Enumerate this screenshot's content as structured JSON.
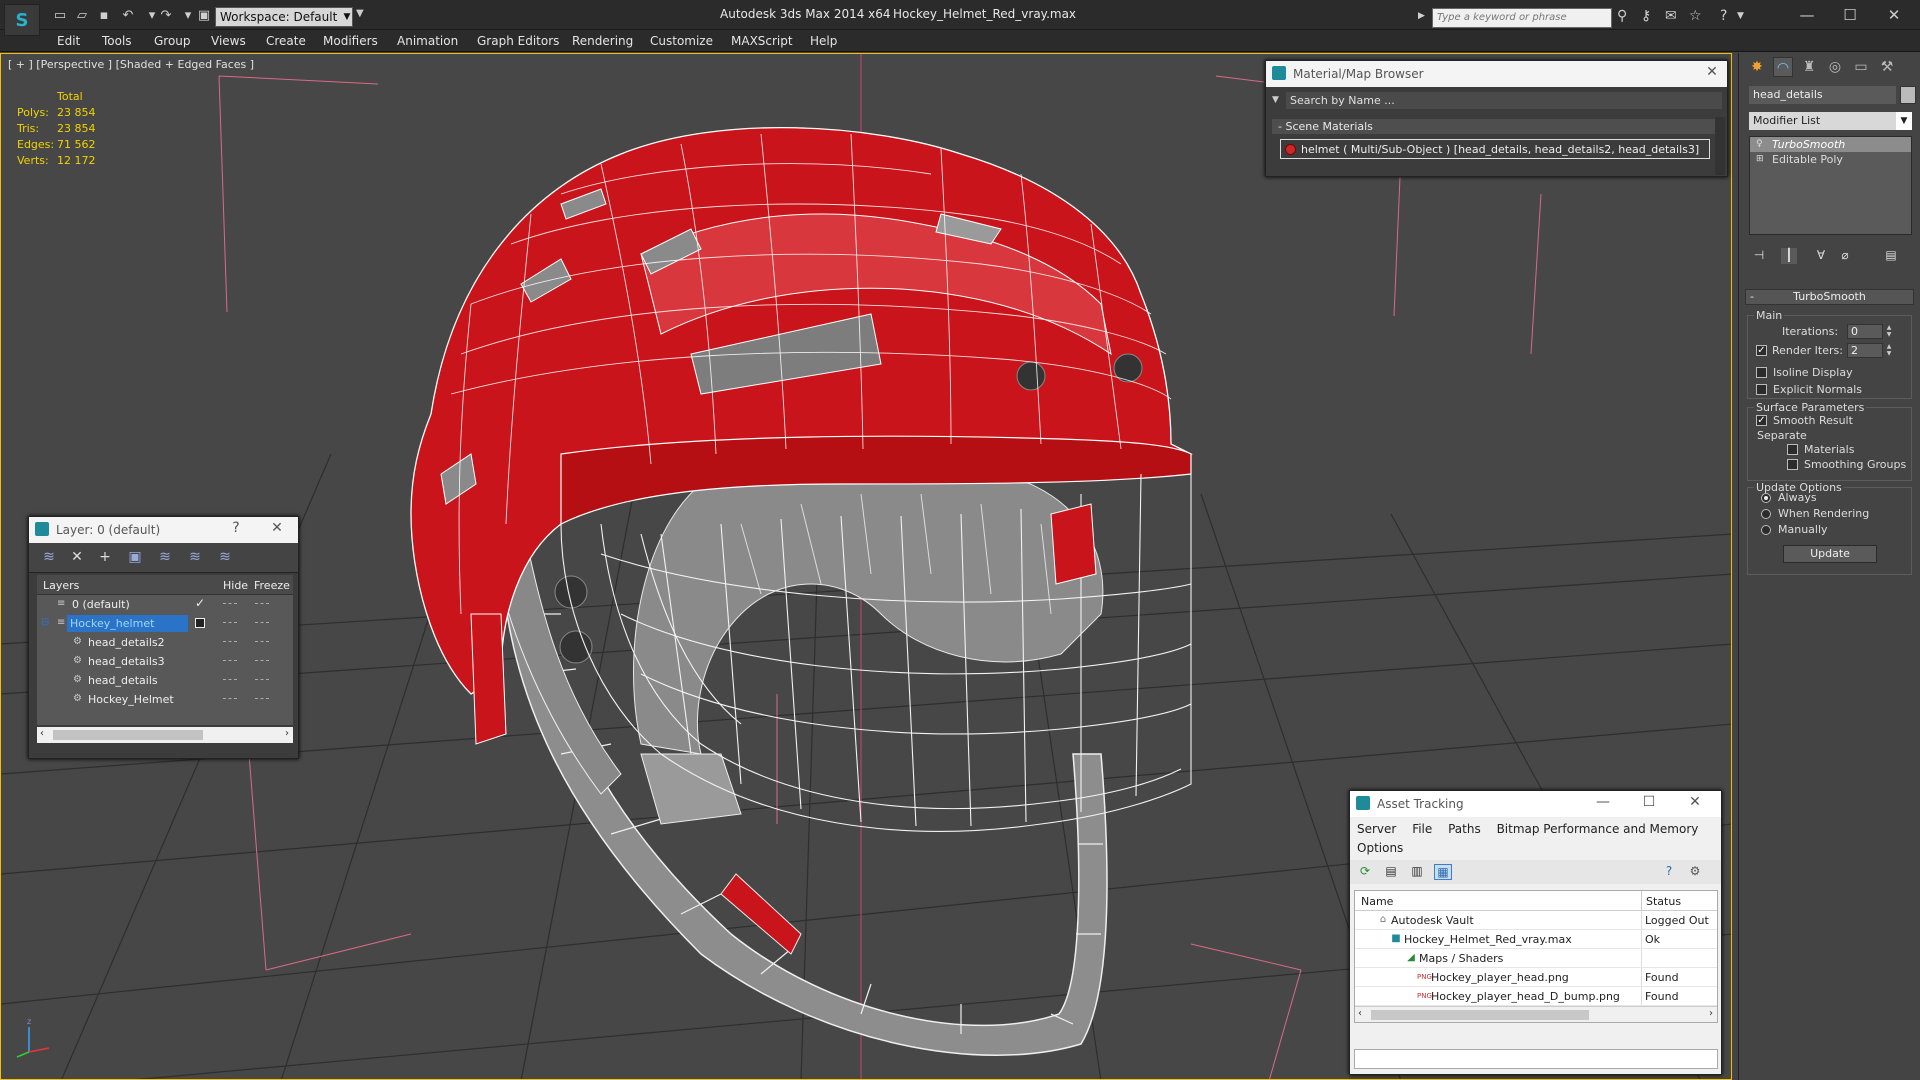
{
  "titlebar": {
    "workspace": "Workspace: Default",
    "app_title": "Autodesk 3ds Max  2014 x64",
    "file_title": "Hockey_Helmet_Red_vray.max",
    "search_placeholder": "Type a keyword or phrase"
  },
  "menu": [
    "Edit",
    "Tools",
    "Group",
    "Views",
    "Create",
    "Modifiers",
    "Animation",
    "Graph Editors",
    "Rendering",
    "Customize",
    "MAXScript",
    "Help"
  ],
  "viewport": {
    "label": "[ + ] [Perspective ] [Shaded + Edged Faces ]",
    "stats": {
      "header": "Total",
      "rows": [
        {
          "key": "Polys:",
          "value": "23 854"
        },
        {
          "key": "Tris:",
          "value": "23 854"
        },
        {
          "key": "Edges:",
          "value": "71 562"
        },
        {
          "key": "Verts:",
          "value": "12 172"
        }
      ]
    },
    "accent_color": "#f2d200",
    "helmet_color": "#c8141a"
  },
  "layer_window": {
    "title": "Layer: 0 (default)",
    "help": "?",
    "columns": {
      "layers": "Layers",
      "hide": "Hide",
      "freeze": "Freeze"
    },
    "rows": [
      {
        "name": "0 (default)"
      },
      {
        "name": "Hockey_helmet"
      },
      {
        "name": "head_details2"
      },
      {
        "name": "head_details3"
      },
      {
        "name": "head_details"
      },
      {
        "name": "Hockey_Helmet"
      }
    ]
  },
  "material_browser": {
    "title": "Material/Map Browser",
    "search_placeholder": "Search by Name ...",
    "section": "- Scene Materials",
    "entry": "helmet  ( Multi/Sub-Object )  [head_details, head_details2, head_details3]"
  },
  "asset_tracking": {
    "title": "Asset Tracking",
    "menu": [
      "Server",
      "File",
      "Paths",
      "Bitmap Performance and Memory"
    ],
    "menu2": "Options",
    "columns": {
      "name": "Name",
      "status": "Status"
    },
    "rows": [
      {
        "name": "Autodesk Vault",
        "status": "Logged Out"
      },
      {
        "name": "Hockey_Helmet_Red_vray.max",
        "status": "Ok"
      },
      {
        "name": "Maps / Shaders",
        "status": ""
      },
      {
        "name": "Hockey_player_head.png",
        "status": "Found"
      },
      {
        "name": "Hockey_player_head_D_bump.png",
        "status": "Found"
      }
    ]
  },
  "command_panel": {
    "object_name": "head_details",
    "modifier_list": "Modifier List",
    "stack": [
      "TurboSmooth",
      "Editable Poly"
    ],
    "turbosmooth": {
      "title": "TurboSmooth",
      "main": "Main",
      "iterations_label": "Iterations:",
      "iterations_value": "0",
      "render_iters_label": "Render Iters:",
      "render_iters_value": "2",
      "isoline": "Isoline Display",
      "explicit_normals": "Explicit Normals",
      "surface_params": "Surface Parameters",
      "smooth_result": "Smooth Result",
      "separate": "Separate",
      "materials": "Materials",
      "smoothing_groups": "Smoothing Groups",
      "update_options": "Update Options",
      "always": "Always",
      "when_rendering": "When Rendering",
      "manually": "Manually",
      "update": "Update"
    }
  }
}
